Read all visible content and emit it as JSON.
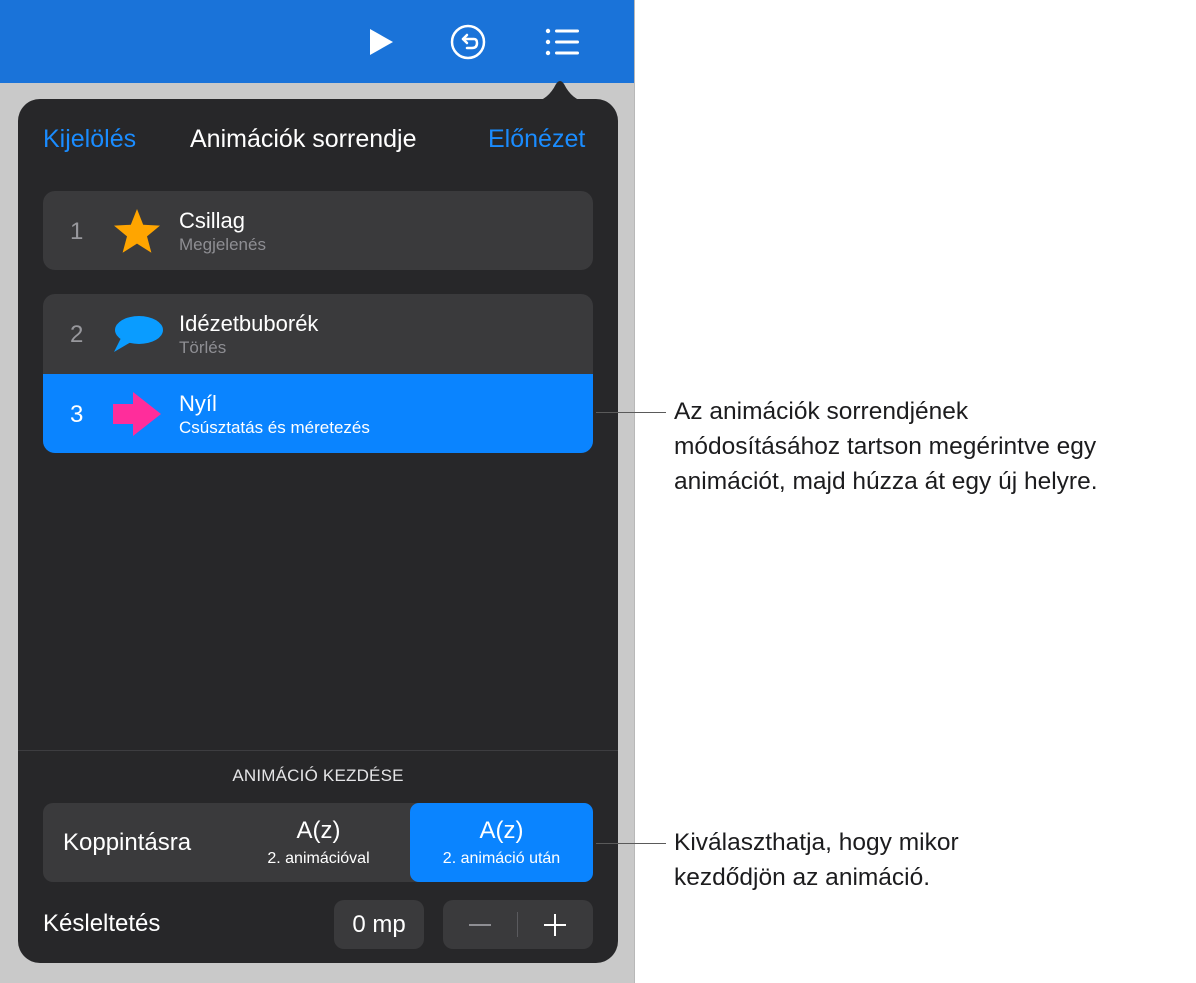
{
  "toolbar": {
    "play_icon": "play-icon",
    "undo_icon": "undo-icon",
    "list_icon": "animation-list-icon"
  },
  "popover": {
    "select_label": "Kijelölés",
    "title": "Animációk sorrendje",
    "preview_label": "Előnézet"
  },
  "animations": [
    {
      "number": "1",
      "name": "Csillag",
      "effect": "Megjelenés",
      "icon": "star-icon",
      "color": "#ffa500"
    },
    {
      "number": "2",
      "name": "Idézetbuborék",
      "effect": "Törlés",
      "icon": "speech-bubble-icon",
      "color": "#0a9cff"
    },
    {
      "number": "3",
      "name": "Nyíl",
      "effect": "Csúsztatás és méretezés",
      "icon": "arrow-icon",
      "color": "#ff2d9b",
      "selected": true
    }
  ],
  "start": {
    "section_label": "ANIMÁCIÓ KEZDÉSE",
    "options": [
      {
        "label": "Koppintásra"
      },
      {
        "label": "A(z)",
        "sublabel": "2. animációval"
      },
      {
        "label": "A(z)",
        "sublabel": "2. animáció után",
        "selected": true
      }
    ]
  },
  "delay": {
    "label": "Késleltetés",
    "value": "0 mp",
    "minus": "−",
    "plus": "+"
  },
  "callouts": {
    "reorder": [
      "Az animációk sorrendjének",
      "módosításához tartson megérintve egy",
      "animációt, majd húzza át egy új helyre."
    ],
    "start": [
      "Kiválaszthatja, hogy mikor",
      "kezdődjön az animáció."
    ]
  },
  "colors": {
    "toolbar": "#1a73d9",
    "accent": "#0a84ff",
    "popover_bg": "#272729",
    "card_bg": "#3a3a3c"
  }
}
